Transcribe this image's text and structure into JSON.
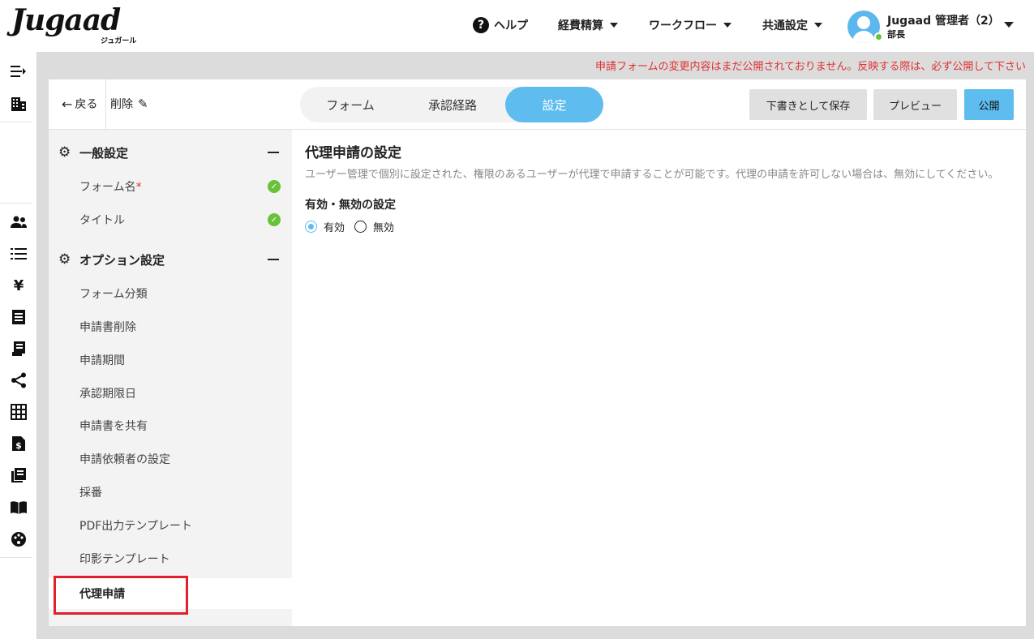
{
  "header": {
    "logo_text": "Jugaad",
    "logo_sub": "ジュガール",
    "nav": [
      {
        "label": "ヘルプ",
        "icon": "help-icon"
      },
      {
        "label": "経費精算"
      },
      {
        "label": "ワークフロー"
      },
      {
        "label": "共通設定"
      }
    ],
    "user": {
      "name": "Jugaad 管理者（2）",
      "role": "部長",
      "status_color": "#67c23a"
    }
  },
  "rail": {
    "icons": [
      "collapse-menu-icon",
      "building-icon",
      "users-icon",
      "list-icon",
      "yen-icon",
      "document-icon",
      "receipt-icon",
      "share-icon",
      "grid-icon",
      "invoice-icon",
      "library-icon",
      "book-icon",
      "palette-icon"
    ]
  },
  "notice": "申請フォームの変更内容はまだ公開されておりません。反映する際は、必ず公開して下さい",
  "toolbar": {
    "back_label": "戻る",
    "form_title": "削除",
    "tabs": [
      {
        "label": "フォーム",
        "active": false
      },
      {
        "label": "承認経路",
        "active": false
      },
      {
        "label": "設定",
        "active": true
      }
    ],
    "save_draft": "下書きとして保存",
    "preview": "プレビュー",
    "publish": "公開"
  },
  "sidebar": {
    "general": {
      "title": "一般設定",
      "items": [
        {
          "label": "フォーム名",
          "required_mark": "*",
          "complete": true
        },
        {
          "label": "タイトル",
          "complete": true
        }
      ]
    },
    "options": {
      "title": "オプション設定",
      "items": [
        {
          "label": "フォーム分類"
        },
        {
          "label": "申請書削除"
        },
        {
          "label": "申請期間"
        },
        {
          "label": "承認期限日"
        },
        {
          "label": "申請書を共有"
        },
        {
          "label": "申請依頼者の設定"
        },
        {
          "label": "採番"
        },
        {
          "label": "PDF出力テンプレート"
        },
        {
          "label": "印影テンプレート"
        },
        {
          "label": "代理申請",
          "active": true
        }
      ]
    }
  },
  "content": {
    "title": "代理申請の設定",
    "description": "ユーザー管理で個別に設定された、権限のあるユーザーが代理で申請することが可能です。代理の申請を許可しない場合は、無効にしてください。",
    "field_label": "有効・無効の設定",
    "options": [
      {
        "label": "有効",
        "checked": true
      },
      {
        "label": "無効",
        "checked": false
      }
    ]
  },
  "colors": {
    "accent": "#5ebcee",
    "notice": "#e03131",
    "success": "#67c23a",
    "highlight": "#e0202c"
  }
}
